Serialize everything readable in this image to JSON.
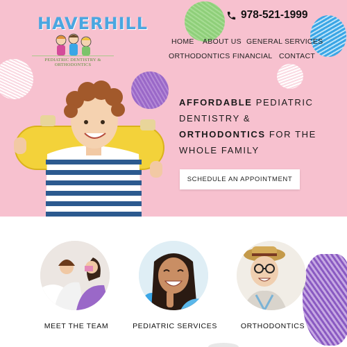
{
  "brand": {
    "logo_word": "HAVERHILL",
    "logo_tagline": "PEDIATRIC DENTISTRY & ORTHODONTICS"
  },
  "header": {
    "phone": "978-521-1999",
    "phone_icon": "phone-icon"
  },
  "nav": {
    "items": [
      "HOME",
      "ABOUT US",
      "GENERAL SERVICES",
      "ORTHODONTICS",
      "FINANCIAL",
      "CONTACT"
    ]
  },
  "hero": {
    "line1_bold": "AFFORDABLE",
    "line1_rest": " PEDIATRIC",
    "line2": "DENTISTRY &",
    "line3_bold": "ORTHODONTICS",
    "line3_rest": " FOR THE",
    "line4": "WHOLE FAMILY",
    "cta_label": "SCHEDULE AN APPOINTMENT"
  },
  "cards": [
    {
      "label": "MEET THE TEAM"
    },
    {
      "label": "PEDIATRIC SERVICES"
    },
    {
      "label": "ORTHODONTICS"
    }
  ],
  "colors": {
    "hero_bg": "#f7c1cf",
    "logo_blue": "#4aa6e0",
    "accent_purple": "#8a5ac2",
    "accent_green": "#8fcf7a",
    "accent_blue": "#3aa6e6"
  }
}
